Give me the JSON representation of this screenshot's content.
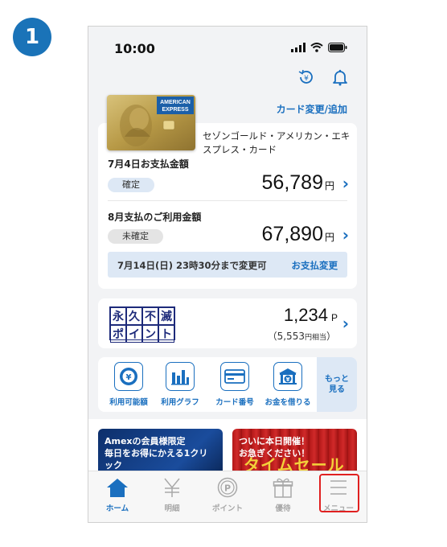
{
  "step_number": "1",
  "status_bar": {
    "time": "10:00"
  },
  "header": {
    "card_change_label": "カード変更/追加"
  },
  "card": {
    "image_text_line1": "AMERICAN",
    "image_text_line2": "EXPRESS",
    "name": "セゾンゴールド・アメリカン・エキスプレス・カード"
  },
  "payment": {
    "confirmed_label": "7月4日お支払金額",
    "confirmed_badge": "確定",
    "confirmed_amount": "56,789",
    "unconfirmed_label": "8月支払のご利用金額",
    "unconfirmed_badge": "未確定",
    "unconfirmed_amount": "67,890",
    "currency_unit": "円",
    "deadline_text": "7月14日(日) 23時30分まで変更可",
    "deadline_link": "お支払変更"
  },
  "points": {
    "logo_chars": [
      "永",
      "久",
      "不",
      "滅",
      "ポ",
      "イ",
      "ン",
      "ト"
    ],
    "value": "1,234",
    "unit": "P",
    "yen_open": "（5,553",
    "yen_small": "円相当",
    "yen_close": "）"
  },
  "quick_menu": {
    "items": [
      {
        "label": "利用可能額",
        "icon": "yen-gauge-icon"
      },
      {
        "label": "利用グラフ",
        "icon": "bar-graph-icon"
      },
      {
        "label": "カード番号",
        "icon": "card-icon"
      },
      {
        "label": "お金を借りる",
        "icon": "bank-icon"
      }
    ],
    "more_line1": "もっと",
    "more_line2": "見る"
  },
  "banners": {
    "banner1_line1": "Amexの会員様限定",
    "banner1_line2": "毎日をお得にかえる1クリック",
    "banner2_line1": "ついに本日開催！",
    "banner2_line2": "お急ぎください！",
    "banner2_big": "タイムセール"
  },
  "tab_bar": {
    "tabs": [
      {
        "label": "ホーム",
        "icon": "home-icon",
        "active": true
      },
      {
        "label": "明細",
        "icon": "yen-icon",
        "active": false
      },
      {
        "label": "ポイント",
        "icon": "point-icon",
        "active": false
      },
      {
        "label": "優待",
        "icon": "gift-icon",
        "active": false
      },
      {
        "label": "メニュー",
        "icon": "hamburger-icon",
        "active": false
      }
    ]
  },
  "colors": {
    "accent": "#1a6fbf",
    "step_badge": "#1a73b8",
    "highlight": "#e02020",
    "inactive": "#a8a8a8"
  }
}
